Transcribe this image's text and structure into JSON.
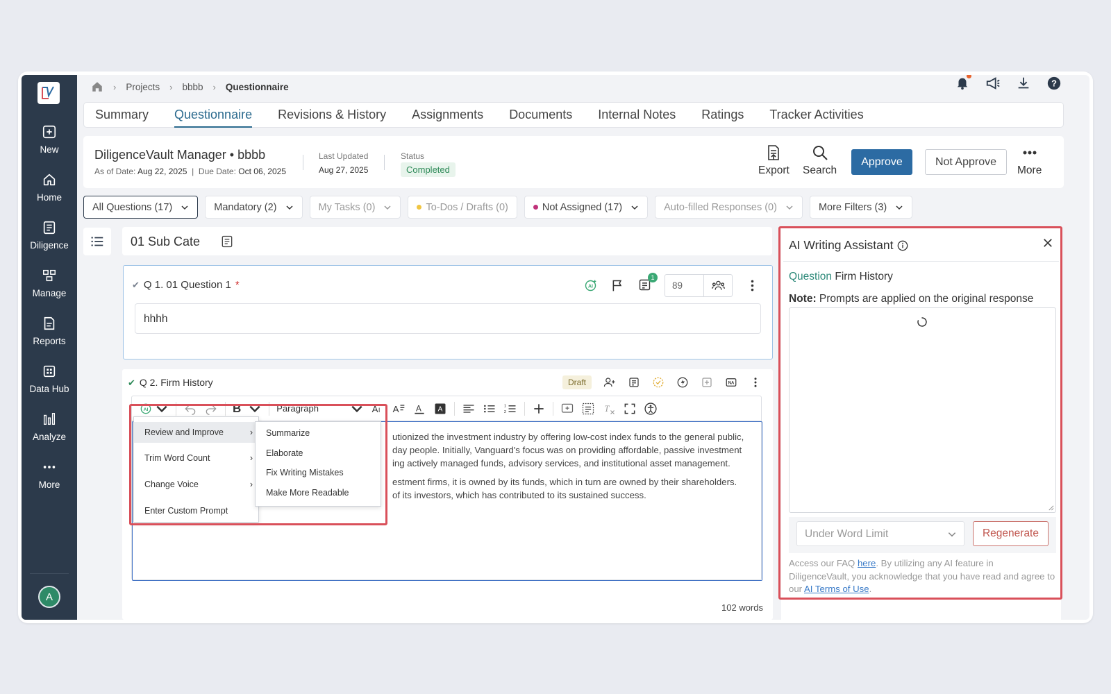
{
  "sidebar": {
    "items": [
      {
        "label": "New",
        "icon": "plus-square-icon"
      },
      {
        "label": "Home",
        "icon": "home-icon"
      },
      {
        "label": "Diligence",
        "icon": "clipboard-icon"
      },
      {
        "label": "Manage",
        "icon": "manage-icon"
      },
      {
        "label": "Reports",
        "icon": "report-icon"
      },
      {
        "label": "Data Hub",
        "icon": "grid-icon"
      },
      {
        "label": "Analyze",
        "icon": "bar-chart-icon"
      },
      {
        "label": "More",
        "icon": "dots-icon"
      }
    ],
    "avatar_initial": "A"
  },
  "breadcrumb": {
    "items": [
      "Projects",
      "bbbb",
      "Questionnaire"
    ]
  },
  "tabs": [
    {
      "label": "Summary"
    },
    {
      "label": "Questionnaire",
      "active": true
    },
    {
      "label": "Revisions & History"
    },
    {
      "label": "Assignments"
    },
    {
      "label": "Documents"
    },
    {
      "label": "Internal Notes"
    },
    {
      "label": "Ratings"
    },
    {
      "label": "Tracker Activities"
    }
  ],
  "header": {
    "title": "DiligenceVault Manager • bbbb",
    "as_of_label": "As of Date:",
    "as_of_value": "Aug 22, 2025",
    "due_label": "Due Date:",
    "due_value": "Oct 06, 2025",
    "last_updated_label": "Last Updated",
    "last_updated_value": "Aug 27, 2025",
    "status_label": "Status",
    "status_value": "Completed",
    "export_label": "Export",
    "search_label": "Search",
    "approve_label": "Approve",
    "not_approve_label": "Not Approve",
    "more_label": "More"
  },
  "filters": {
    "all_questions": "All Questions (17)",
    "mandatory": "Mandatory (2)",
    "my_tasks": "My Tasks (0)",
    "todos": "To-Dos / Drafts (0)",
    "not_assigned": "Not Assigned (17)",
    "auto_filled": "Auto-filled Responses (0)",
    "more_filters": "More Filters (3)"
  },
  "subcategory": {
    "title": "01 Sub Cate"
  },
  "q1": {
    "title": "Q 1. 01 Question 1",
    "required_mark": "*",
    "answer": "hhhh",
    "score": "89",
    "comment_badge": "1"
  },
  "q2": {
    "title": "Q 2. Firm History",
    "draft_label": "Draft",
    "paragraph_label": "Paragraph",
    "lines": [
      "utionized the investment industry by offering low-cost index funds to the general public,",
      "day people. Initially, Vanguard's focus was on providing affordable, passive investment",
      "ing actively managed funds, advisory services, and institutional asset management.",
      "estment firms, it is owned by its funds, which in turn are owned by their shareholders.",
      "of its investors, which has contributed to its sustained success."
    ],
    "word_count": "102 words"
  },
  "ai_menu": {
    "items": [
      "Review and Improve",
      "Trim Word Count",
      "Change Voice",
      "Enter Custom Prompt"
    ],
    "submenu": [
      "Summarize",
      "Elaborate",
      "Fix Writing Mistakes",
      "Make More Readable"
    ]
  },
  "ai_panel": {
    "title": "AI Writing Assistant",
    "question_label": "Question",
    "question_value": "Firm History",
    "note_label": "Note:",
    "note_text": "Prompts are applied on the original response",
    "word_limit_placeholder": "Under Word Limit",
    "regenerate_label": "Regenerate",
    "disclaimer_1": "Access our FAQ ",
    "faq_link": "here",
    "disclaimer_2": ". By utilizing any AI feature in DiligenceVault, you acknowledge that you have read and agree to our ",
    "terms_link": "AI Terms of Use",
    "disclaimer_3": "."
  },
  "colors": {
    "sidebar": "#2c3a4b",
    "accent": "#2b6a8e",
    "approve": "#2c6ba3",
    "highlight_box": "#d9505a",
    "status_green": "#2e8a58"
  }
}
